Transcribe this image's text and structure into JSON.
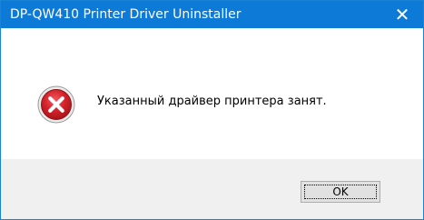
{
  "window": {
    "title": "DP-QW410 Printer Driver Uninstaller",
    "close_glyph": "✕"
  },
  "dialog": {
    "icon": "error-icon",
    "message": "Указанный драйвер принтера занят."
  },
  "buttons": {
    "ok_label": "OK"
  },
  "colors": {
    "titlebar": "#0e7ad8",
    "error_red": "#d0222a",
    "footer": "#f0f0f0"
  }
}
